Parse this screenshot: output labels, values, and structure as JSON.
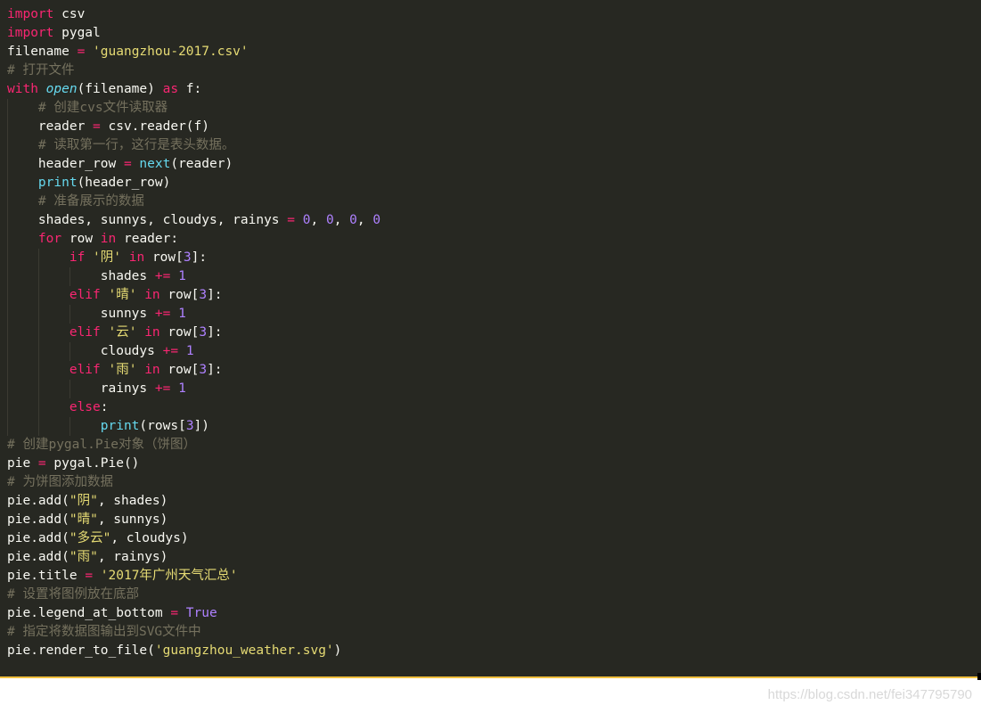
{
  "editor": {
    "lines": [
      "import csv",
      "import pygal",
      "filename = 'guangzhou-2017.csv'",
      "# 打开文件",
      "with open(filename) as f:",
      "    # 创建cvs文件读取器",
      "    reader = csv.reader(f)",
      "    # 读取第一行，这行是表头数据。",
      "    header_row = next(reader)",
      "    print(header_row)",
      "    # 准备展示的数据",
      "    shades, sunnys, cloudys, rainys = 0, 0, 0, 0",
      "    for row in reader:",
      "        if '阴' in row[3]:",
      "            shades += 1",
      "        elif '晴' in row[3]:",
      "            sunnys += 1",
      "        elif '云' in row[3]:",
      "            cloudys += 1",
      "        elif '雨' in row[3]:",
      "            rainys += 1",
      "        else:",
      "            print(rows[3])",
      "# 创建pygal.Pie对象（饼图）",
      "pie = pygal.Pie()",
      "# 为饼图添加数据",
      "pie.add(\"阴\", shades)",
      "pie.add(\"晴\", sunnys)",
      "pie.add(\"多云\", cloudys)",
      "pie.add(\"雨\", rainys)",
      "pie.title = '2017年广州天气汇总'",
      "# 设置将图例放在底部",
      "pie.legend_at_bottom = True",
      "# 指定将数据图输出到SVG文件中",
      "pie.render_to_file('guangzhou_weather.svg')"
    ]
  },
  "watermark": "https://blog.csdn.net/fei347795790",
  "colors": {
    "background": "#272822",
    "keyword": "#f92672",
    "function": "#66d9ef",
    "string": "#e6db74",
    "number": "#ae81ff",
    "comment": "#75715e",
    "text": "#f8f8f2"
  }
}
